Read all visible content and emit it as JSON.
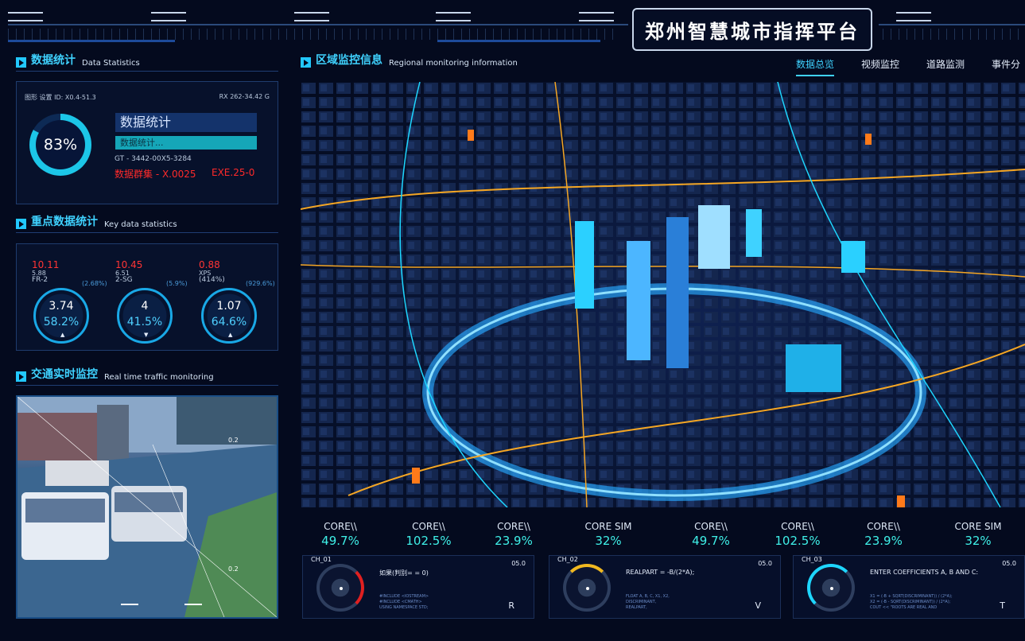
{
  "header": {
    "title": "郑州智慧城市指挥平台"
  },
  "colors": {
    "accent": "#3fd2ff",
    "cyan": "#15a6b8",
    "alert": "#ff2a2a",
    "bg": "#040a1e"
  },
  "data_stats": {
    "title_cn": "数据统计",
    "title_en": "Data Statistics",
    "meta_left": "图形 设置 ID: X0.4-51.3",
    "meta_right": "RX 262-34.42 G",
    "percent": "83%",
    "percent_value": 0.83,
    "big_title": "数据统计",
    "bar_text": "数据统计...",
    "code": "GT - 3442-00X5-3284",
    "red_left": "数据群集 - X.0025",
    "red_right": "EXE.25-0"
  },
  "key_stats": {
    "title_cn": "重点数据统计",
    "title_en": "Key data statistics",
    "cards": [
      {
        "top": "10.11",
        "sub1": "5.88",
        "sub2": "FR-2",
        "tag": "(2.68%)",
        "value": "3.74",
        "percent": "58.2%",
        "arrow": "▲"
      },
      {
        "top": "10.45",
        "sub1": "6.51",
        "sub2": "2-SG",
        "tag": "(5.9%)",
        "value": "4",
        "percent": "41.5%",
        "arrow": "▼"
      },
      {
        "top": "0.88",
        "sub1": "XPS",
        "sub2": "(414%)",
        "tag": "(929.6%)",
        "value": "1.07",
        "percent": "64.6%",
        "arrow": "▲"
      }
    ]
  },
  "traffic": {
    "title_cn": "交通实时监控",
    "title_en": "Real time traffic monitoring",
    "labels": [
      "0.2",
      "0.2"
    ]
  },
  "region": {
    "title_cn": "区域监控信息",
    "title_en": "Regional monitoring information"
  },
  "tabs": [
    {
      "label": "数据总览"
    },
    {
      "label": "视频监控"
    },
    {
      "label": "道路监测"
    },
    {
      "label": "事件分"
    }
  ],
  "cores": [
    {
      "label": "CORE\\\\",
      "value": "49.7%"
    },
    {
      "label": "CORE\\\\",
      "value": "102.5%"
    },
    {
      "label": "CORE\\\\",
      "value": "23.9%"
    },
    {
      "label": "CORE SIM",
      "value": "32%"
    },
    {
      "label": "CORE\\\\",
      "value": "49.7%"
    },
    {
      "label": "CORE\\\\",
      "value": "102.5%"
    },
    {
      "label": "CORE\\\\",
      "value": "23.9%"
    },
    {
      "label": "CORE SIM",
      "value": "32%"
    }
  ],
  "channels": [
    {
      "ch": "CH_01",
      "eq": "如果(判别= = 0)",
      "ver": "05.0",
      "letter": "R",
      "code1": "#INCLUDE <IOSTREAM>",
      "code2": "#INCLUDE <CMATH>",
      "code3": "USING NAMESPACE STD;"
    },
    {
      "ch": "CH_02",
      "eq": "REALPART = -B/(2*A);",
      "ver": "05.0",
      "letter": "V",
      "code1": "FLOAT A, B, C, X1, X2,",
      "code2": "DISCRIMINANT,",
      "code3": "REALPART,"
    },
    {
      "ch": "CH_03",
      "eq": "ENTER COEFFICIENTS A, B AND C:",
      "ver": "05.0",
      "letter": "T",
      "code1": "X1 = (-B + SQRT(DISCRIMINANT)) / (2*A);",
      "code2": "X2 = (-B - SQRT(DISCRIMINANT)) / (2*A);",
      "code3": "COUT << \"ROOTS ARE REAL AND"
    }
  ]
}
